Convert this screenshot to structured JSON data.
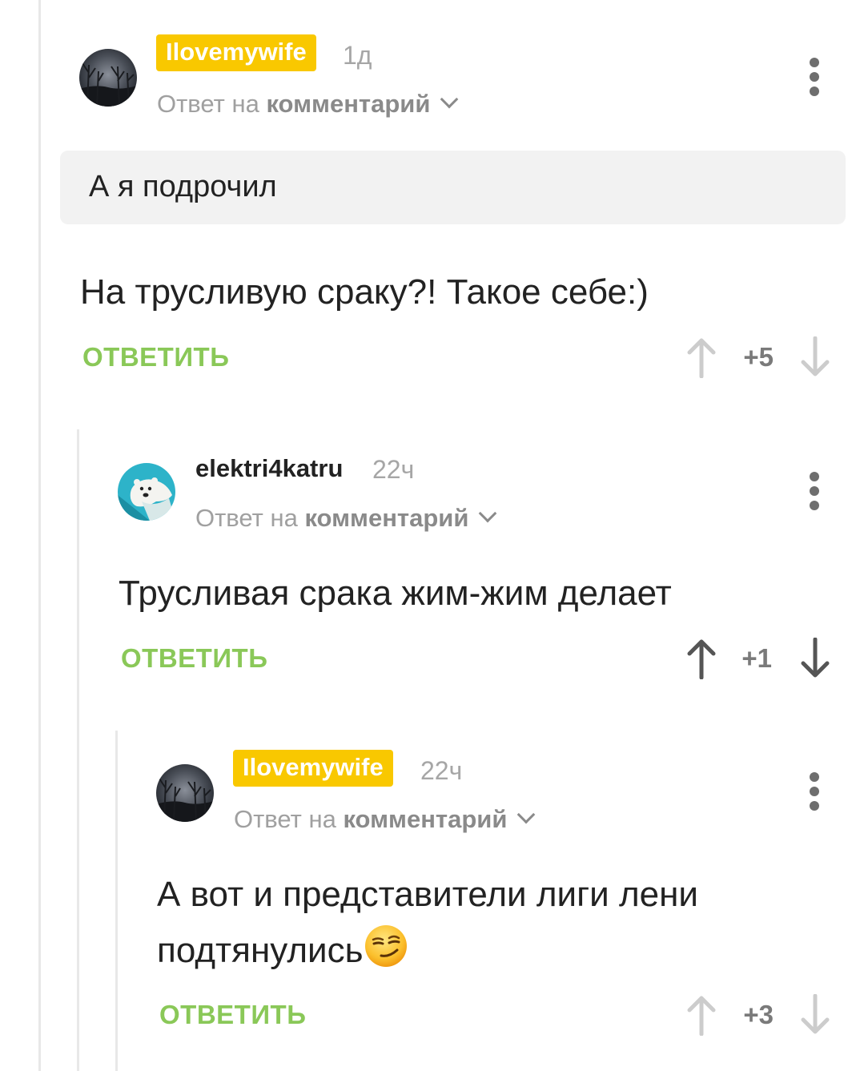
{
  "comments": [
    {
      "username": "Ilovemywife",
      "time": "1д",
      "reply_prefix": "Ответ на",
      "reply_target": "комментарий",
      "quote": "А я подрочил",
      "text": "На трусливую сраку?! Такое себе:)",
      "reply_label": "ОТВЕТИТЬ",
      "score": "+5"
    },
    {
      "username": "elektri4katru",
      "time": "22ч",
      "reply_prefix": "Ответ на",
      "reply_target": "комментарий",
      "text": "Трусливая срака жим-жим делает",
      "reply_label": "ОТВЕТИТЬ",
      "score": "+1"
    },
    {
      "username": "Ilovemywife",
      "time": "22ч",
      "reply_prefix": "Ответ на",
      "reply_target": "комментарий",
      "text_line1": "А вот и представители лиги лени",
      "text_line2": "подтянулись",
      "emoji": "smirking-face",
      "reply_label": "ОТВЕТИТЬ",
      "score": "+3"
    }
  ],
  "colors": {
    "badge": "#f9c800",
    "reply_green": "#8ac858",
    "meta_gray": "#a0a0a0",
    "thread_line": "#e8e8e8"
  }
}
